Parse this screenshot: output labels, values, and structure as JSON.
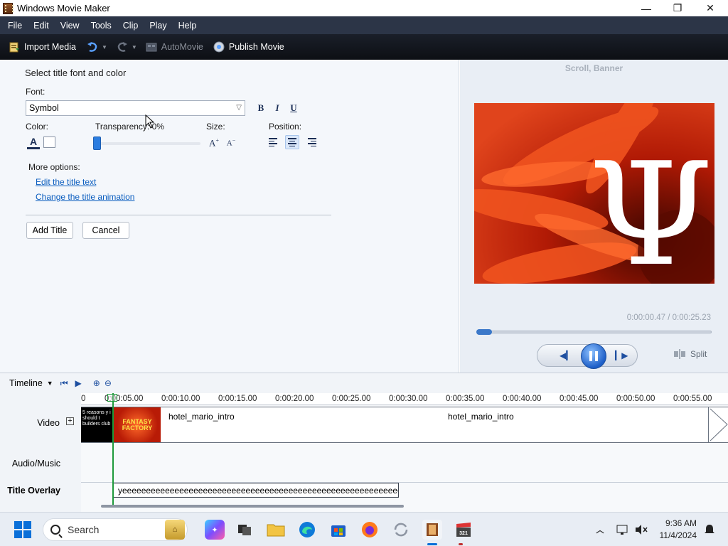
{
  "window": {
    "title": "Windows Movie Maker",
    "controls": [
      "—",
      "❐",
      "✕"
    ]
  },
  "menu": [
    "File",
    "Edit",
    "View",
    "Tools",
    "Clip",
    "Play",
    "Help"
  ],
  "toolbar": {
    "import_media": "Import Media",
    "automovie": "AutoMovie",
    "publish_movie": "Publish Movie"
  },
  "title_panel": {
    "heading": "Select title font and color",
    "font_label": "Font:",
    "font_value": "Symbol",
    "format": {
      "bold": "B",
      "italic": "I",
      "underline": "U"
    },
    "color_label": "Color:",
    "transparency_label": "Transparency: 0%",
    "transparency_value": 0,
    "size_label": "Size:",
    "position_label": "Position:",
    "position_selected": "center",
    "more_options_label": "More options:",
    "edit_text_link": "Edit the title text",
    "change_animation_link": "Change the title animation",
    "add_title_button": "Add Title",
    "cancel_button": "Cancel"
  },
  "preview": {
    "title": "Scroll, Banner",
    "overlay_text": "Ψ",
    "time_readout": "0:00:00.47 / 0:00:25.23",
    "progress": 0.02,
    "split_label": "Split"
  },
  "timeline": {
    "label": "Timeline",
    "ticks": [
      "0",
      "0:00:05.00",
      "0:00:10.00",
      "0:00:15.00",
      "0:00:20.00",
      "0:00:25.00",
      "0:00:30.00",
      "0:00:35.00",
      "0:00:40.00",
      "0:00:45.00",
      "0:00:50.00",
      "0:00:55.00"
    ],
    "tracks": {
      "video": "Video",
      "audio": "Audio/Music",
      "title": "Title Overlay"
    },
    "clip1_thumb_text": "5 reasons y i should t builders club",
    "clip2_thumb_text": "FANTASY FACTORY",
    "clip_name_1": "hotel_mario_intro",
    "clip_name_2": "hotel_mario_intro",
    "title_clip_text": "yeeeeeeeeeeeeeeeeeeeeeeeeeeeeeeeeeeeeeeeeeeeeeeeeeeeeeeeeeeeeeeee..."
  },
  "taskbar": {
    "search_placeholder": "Search",
    "time": "9:36 AM",
    "date": "11/4/2024"
  },
  "colors": {
    "menubar": "#2c3547",
    "toolbar": "#0d0f14",
    "accent": "#0a5dbf",
    "playhead": "#1f9a3b"
  }
}
